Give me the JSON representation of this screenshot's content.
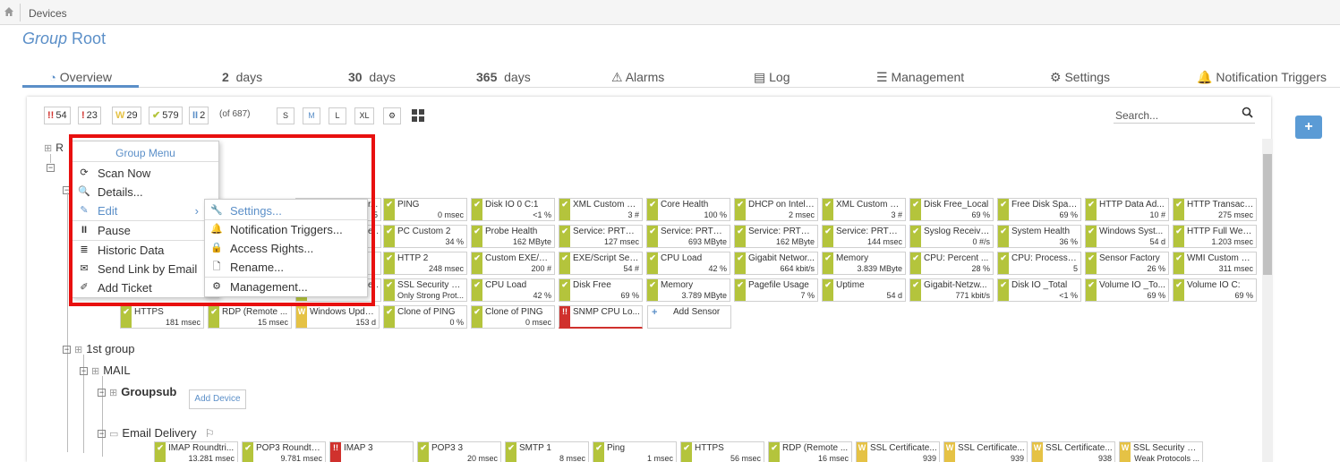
{
  "breadcrumb": {
    "label": "Devices"
  },
  "title": {
    "prefix": "Group",
    "name": "Root"
  },
  "tabs": [
    {
      "num": "",
      "label": "Overview"
    },
    {
      "num": "2",
      "label": "days"
    },
    {
      "num": "30",
      "label": "days"
    },
    {
      "num": "365",
      "label": "days"
    },
    {
      "num": "",
      "label": "Alarms"
    },
    {
      "num": "",
      "label": "Log"
    },
    {
      "num": "",
      "label": "Management"
    },
    {
      "num": "",
      "label": "Settings"
    },
    {
      "num": "",
      "label": "Notification Triggers"
    }
  ],
  "badges": [
    {
      "icon": "!!",
      "count": "54",
      "color": "#d0312d"
    },
    {
      "icon": "!",
      "count": "23",
      "color": "#d0312d"
    },
    {
      "icon": "W",
      "count": "29",
      "color": "#e5c245"
    },
    {
      "icon": "✔",
      "count": "579",
      "color": "#b4c43c"
    },
    {
      "icon": "II",
      "count": "2",
      "color": "#5b8fc8"
    }
  ],
  "total": "(of 687)",
  "sizes": [
    "S",
    "M",
    "L",
    "XL"
  ],
  "search": {
    "placeholder": "Search..."
  },
  "tree": {
    "root_label": "R",
    "first_group": "1st group",
    "mail": "MAIL",
    "groupsub": "Groupsub",
    "add_device": "Add Device",
    "email_delivery": "Email Delivery"
  },
  "group_menu": {
    "title": "Group Menu",
    "items": [
      "Scan Now",
      "Details...",
      "Edit",
      "Pause",
      "Historic Data",
      "Send Link by Email",
      "Add Ticket"
    ]
  },
  "edit_menu": {
    "items": [
      "Settings...",
      "Notification Triggers...",
      "Access Rights...",
      "Rename...",
      "Management..."
    ]
  },
  "sensors": [
    {
      "name": "PING",
      "value": "0 msec",
      "status": "ok"
    },
    {
      "name": "Disk IO 0 C:1",
      "value": "<1 %",
      "status": "ok"
    },
    {
      "name": "XML Custom E...",
      "value": "3 #",
      "status": "ok"
    },
    {
      "name": "Core Health",
      "value": "100 %",
      "status": "ok"
    },
    {
      "name": "DHCP on Intel(...",
      "value": "2 msec",
      "status": "ok"
    },
    {
      "name": "XML Custom E...",
      "value": "3 #",
      "status": "ok"
    },
    {
      "name": "Disk Free_Local",
      "value": "69 %",
      "status": "ok"
    },
    {
      "name": "Free Disk Spac...",
      "value": "69 %",
      "status": "ok"
    },
    {
      "name": "HTTP Data Ad...",
      "value": "10 #",
      "status": "ok"
    },
    {
      "name": "HTTP Transact...",
      "value": "275 msec",
      "status": "ok"
    },
    {
      "name": "PC Custom 2",
      "value": "34 %",
      "status": "ok"
    },
    {
      "name": "Probe Health",
      "value": "162 MByte",
      "status": "ok"
    },
    {
      "name": "Service: PRTG ...",
      "value": "127 msec",
      "status": "ok"
    },
    {
      "name": "Service: PRTG ...",
      "value": "693 MByte",
      "status": "ok"
    },
    {
      "name": "Service: PRTG ...",
      "value": "162 MByte",
      "status": "ok"
    },
    {
      "name": "Service: PRTG ...",
      "value": "144 msec",
      "status": "ok"
    },
    {
      "name": "Syslog Receive...",
      "value": "0 #/s",
      "status": "ok"
    },
    {
      "name": "System Health",
      "value": "36 %",
      "status": "ok"
    },
    {
      "name": "Windows Syst...",
      "value": "54 d",
      "status": "ok"
    },
    {
      "name": "HTTP Full Web...",
      "value": "1.203 msec",
      "status": "ok"
    },
    {
      "name": "HTTP 2",
      "value": "248 msec",
      "status": "ok"
    },
    {
      "name": "Custom EXE/S...",
      "value": "200 #",
      "status": "ok"
    },
    {
      "name": "EXE/Script Sen...",
      "value": "54 #",
      "status": "ok"
    },
    {
      "name": "CPU Load",
      "value": "42 %",
      "status": "ok"
    },
    {
      "name": "Gigabit Networ...",
      "value": "664 kbit/s",
      "status": "ok"
    },
    {
      "name": "Memory",
      "value": "3.839 MByte",
      "status": "ok"
    },
    {
      "name": "CPU: Percent ...",
      "value": "28 %",
      "status": "ok"
    },
    {
      "name": "CPU: Processo...",
      "value": "5",
      "status": "ok"
    },
    {
      "name": "Sensor Factory",
      "value": "26 %",
      "status": "ok"
    },
    {
      "name": "WMI Custom S...",
      "value": "311 msec",
      "status": "ok"
    },
    {
      "name": "SSL Security C...",
      "value": "Only Strong Prot...",
      "status": "ok"
    },
    {
      "name": "CPU Load",
      "value": "42 %",
      "status": "ok"
    },
    {
      "name": "Disk Free",
      "value": "69 %",
      "status": "ok"
    },
    {
      "name": "Memory",
      "value": "3.789 MByte",
      "status": "ok"
    },
    {
      "name": "Pagefile Usage",
      "value": "7 %",
      "status": "ok"
    },
    {
      "name": "Uptime",
      "value": "54 d",
      "status": "ok"
    },
    {
      "name": "Gigabit-Netzw...",
      "value": "771 kbit/s",
      "status": "ok"
    },
    {
      "name": "Disk IO _Total",
      "value": "<1 %",
      "status": "ok"
    },
    {
      "name": "Volume IO _To...",
      "value": "69 %",
      "status": "ok"
    },
    {
      "name": "Volume IO C:",
      "value": "69 %",
      "status": "ok"
    },
    {
      "name": "HTTPS",
      "value": "181 msec",
      "status": "ok"
    },
    {
      "name": "RDP (Remote ...",
      "value": "15 msec",
      "status": "ok"
    },
    {
      "name": "Windows Upda...",
      "value": "153 d",
      "status": "warn"
    },
    {
      "name": "Clone of PING",
      "value": "0 %",
      "status": "ok"
    },
    {
      "name": "Clone of PING",
      "value": "0 msec",
      "status": "ok"
    },
    {
      "name": "SNMP CPU Lo...",
      "value": "",
      "status": "down"
    },
    {
      "name": "IMAP Roundtri...",
      "value": "13.281 msec",
      "status": "ok"
    },
    {
      "name": "POP3 Roundtri...",
      "value": "9.781 msec",
      "status": "ok"
    },
    {
      "name": "IMAP 3",
      "value": "",
      "status": "down"
    },
    {
      "name": "POP3 3",
      "value": "20 msec",
      "status": "ok"
    },
    {
      "name": "SMTP 1",
      "value": "8 msec",
      "status": "ok"
    },
    {
      "name": "Ping",
      "value": "1 msec",
      "status": "ok"
    },
    {
      "name": "HTTPS",
      "value": "56 msec",
      "status": "ok"
    },
    {
      "name": "RDP (Remote ...",
      "value": "16 msec",
      "status": "ok"
    },
    {
      "name": "SSL Certificate...",
      "value": "939",
      "status": "warn"
    },
    {
      "name": "SSL Certificate...",
      "value": "939",
      "status": "warn"
    },
    {
      "name": "SSL Certificate...",
      "value": "938",
      "status": "warn"
    },
    {
      "name": "SSL Security C...",
      "value": "Weak Protocols ...",
      "status": "warn"
    }
  ],
  "partial_labels": [
    "...",
    "5",
    "r...",
    "e...",
    "50",
    "e..."
  ],
  "add_sensor": "Add Sensor"
}
